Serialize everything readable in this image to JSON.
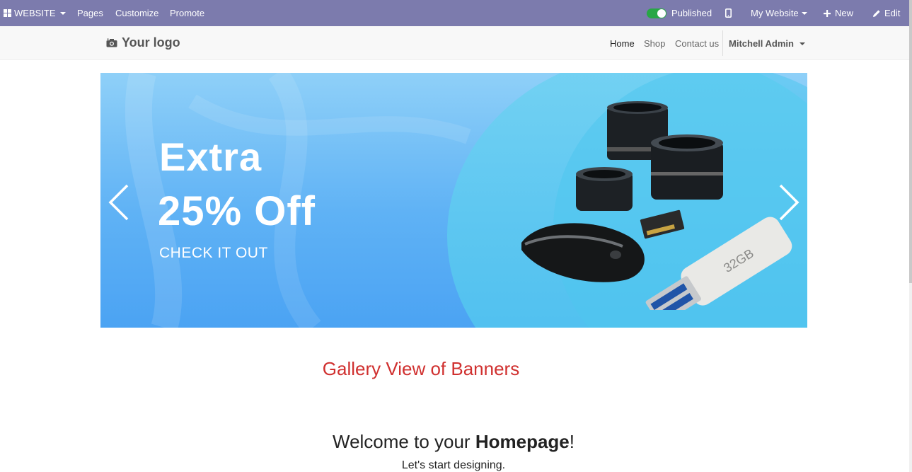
{
  "adminbar": {
    "app_label": "WEBSITE",
    "menu": [
      "Pages",
      "Customize",
      "Promote"
    ],
    "published_label": "Published",
    "website_selector": "My Website",
    "new_label": "New",
    "edit_label": "Edit",
    "accent_color": "#7c7bad",
    "toggle_color": "#28a745"
  },
  "navbar": {
    "logo_text": "Your logo",
    "links": [
      "Home",
      "Shop",
      "Contact us"
    ],
    "active_link": "Home",
    "user_name": "Mitchell Admin"
  },
  "banner": {
    "line1": "Extra",
    "line2": "25% Off",
    "cta": "CHECK IT OUT",
    "usb_label": "32GB",
    "icons": [
      "chevron-left-icon",
      "chevron-right-icon"
    ]
  },
  "content": {
    "gallery_title": "Gallery View of Banners",
    "welcome_prefix": "Welcome to your ",
    "welcome_bold": "Homepage",
    "welcome_suffix": "!",
    "subtitle": "Let's start designing.",
    "gallery_color": "#d0302f"
  }
}
